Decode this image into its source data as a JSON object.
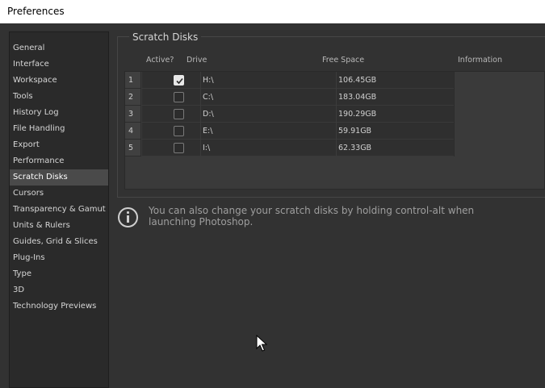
{
  "window": {
    "title": "Preferences"
  },
  "sidebar": {
    "items": [
      {
        "label": "General"
      },
      {
        "label": "Interface"
      },
      {
        "label": "Workspace"
      },
      {
        "label": "Tools"
      },
      {
        "label": "History Log"
      },
      {
        "label": "File Handling"
      },
      {
        "label": "Export"
      },
      {
        "label": "Performance"
      },
      {
        "label": "Scratch Disks",
        "selected": true
      },
      {
        "label": "Cursors"
      },
      {
        "label": "Transparency & Gamut"
      },
      {
        "label": "Units & Rulers"
      },
      {
        "label": "Guides, Grid & Slices"
      },
      {
        "label": "Plug-Ins"
      },
      {
        "label": "Type"
      },
      {
        "label": "3D"
      },
      {
        "label": "Technology Previews"
      }
    ]
  },
  "scratch_disks": {
    "title": "Scratch Disks",
    "columns": {
      "active": "Active?",
      "drive": "Drive",
      "free_space": "Free Space",
      "information": "Information"
    },
    "rows": [
      {
        "num": "1",
        "active": true,
        "drive": "H:\\",
        "free_space": "106.45GB",
        "information": ""
      },
      {
        "num": "2",
        "active": false,
        "drive": "C:\\",
        "free_space": "183.04GB",
        "information": ""
      },
      {
        "num": "3",
        "active": false,
        "drive": "D:\\",
        "free_space": "190.29GB",
        "information": ""
      },
      {
        "num": "4",
        "active": false,
        "drive": "E:\\",
        "free_space": "59.91GB",
        "information": ""
      },
      {
        "num": "5",
        "active": false,
        "drive": "I:\\",
        "free_space": "62.33GB",
        "information": ""
      }
    ]
  },
  "note": {
    "icon": "info-icon",
    "text": "You can also change your scratch disks by holding control-alt when launching Photoshop."
  },
  "colors": {
    "panel": "#323232",
    "selected": "#4a4a4a",
    "text": "#d6d6d6"
  }
}
